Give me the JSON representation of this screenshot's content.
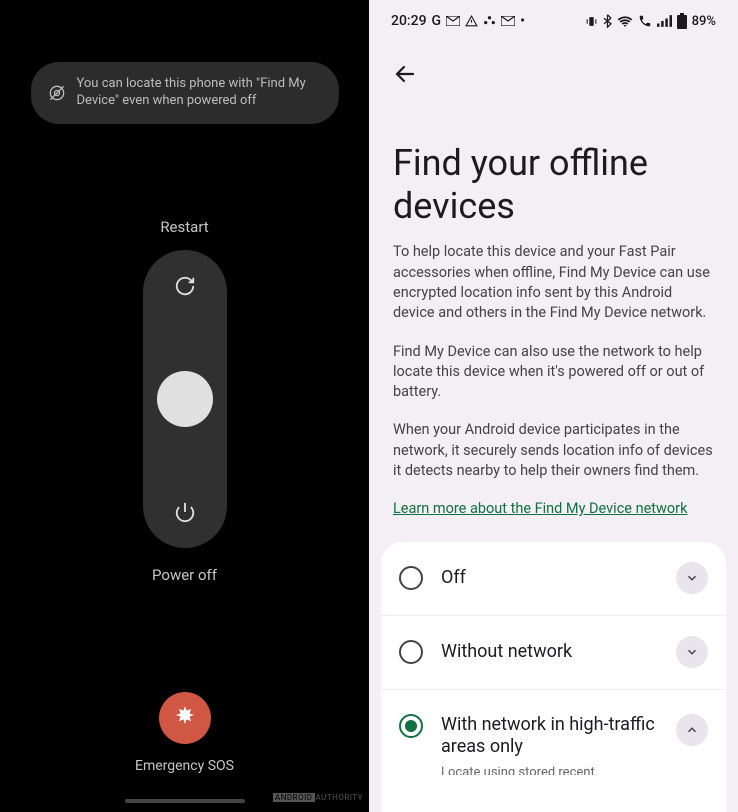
{
  "left": {
    "toast_text": "You can locate this phone with \"Find My Device\" even when powered off",
    "restart_label": "Restart",
    "poweroff_label": "Power off",
    "sos_label": "Emergency SOS",
    "authority_brand": "ANDROID",
    "authority_word": "AUTHORITY"
  },
  "right": {
    "statusbar": {
      "time": "20:29",
      "battery": "89%"
    },
    "title": "Find your offline devices",
    "para1": "To help locate this device and your Fast Pair accessories when offline, Find My Device can use encrypted location info sent by this Android device and others in the Find My Device network.",
    "para2": "Find My Device can also use the network to help locate this device when it's powered off or out of battery.",
    "para3": "When your Android device participates in the network, it securely sends location info of devices it detects nearby to help their owners find them.",
    "learn_link": "Learn more about the Find My Device network",
    "options": [
      {
        "label": "Off",
        "selected": false,
        "expanded": false
      },
      {
        "label": "Without network",
        "selected": false,
        "expanded": false
      },
      {
        "label": "With network in high-traffic areas only",
        "selected": true,
        "expanded": true,
        "sub": "Locate using stored recent"
      }
    ]
  }
}
